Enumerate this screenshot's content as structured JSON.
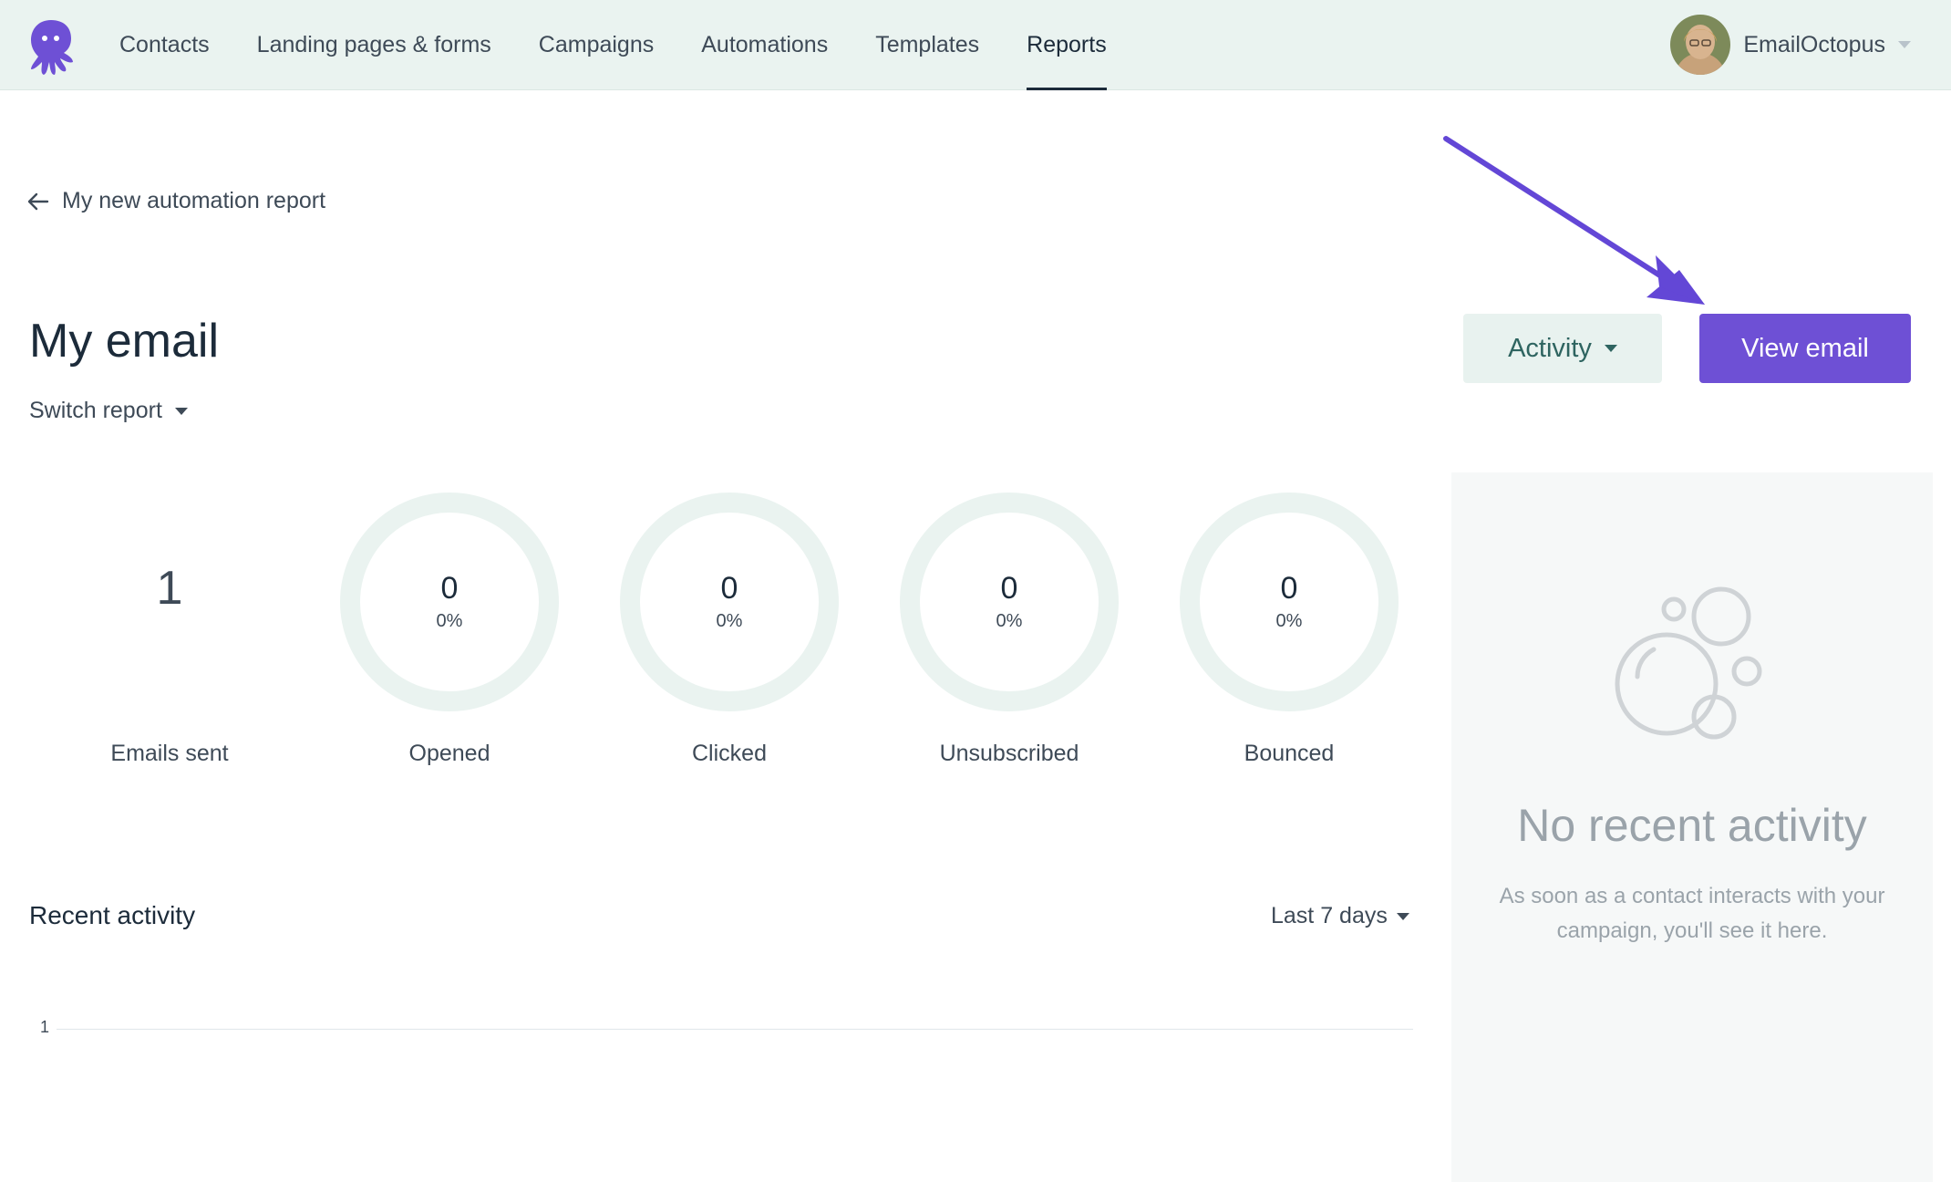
{
  "nav": {
    "items": [
      {
        "label": "Contacts"
      },
      {
        "label": "Landing pages & forms"
      },
      {
        "label": "Campaigns"
      },
      {
        "label": "Automations"
      },
      {
        "label": "Templates"
      },
      {
        "label": "Reports"
      }
    ],
    "active": "Reports",
    "account_name": "EmailOctopus"
  },
  "breadcrumb": {
    "back_label": "My new automation report"
  },
  "page": {
    "title": "My email",
    "switch_label": "Switch report",
    "activity_button": "Activity",
    "view_button": "View email"
  },
  "stats": [
    {
      "value": "1",
      "label": "Emails sent"
    },
    {
      "value": "0",
      "percent": "0%",
      "label": "Opened"
    },
    {
      "value": "0",
      "percent": "0%",
      "label": "Clicked"
    },
    {
      "value": "0",
      "percent": "0%",
      "label": "Unsubscribed"
    },
    {
      "value": "0",
      "percent": "0%",
      "label": "Bounced"
    }
  ],
  "recent": {
    "title": "Recent activity",
    "range": "Last 7 days",
    "axis_tick": "1"
  },
  "side": {
    "title": "No recent activity",
    "description": "As soon as a contact interacts with your campaign, you'll see it here."
  },
  "colors": {
    "accent": "#6e50d5",
    "nav_bg": "#eaf3f0",
    "ring": "#eaf3f0",
    "activity_text": "#2e6460"
  },
  "icons": {
    "logo": "octopus-logo",
    "back": "arrow-left-icon",
    "empty_state": "bubbles-icon",
    "annotation": "arrow-annotation-icon"
  }
}
